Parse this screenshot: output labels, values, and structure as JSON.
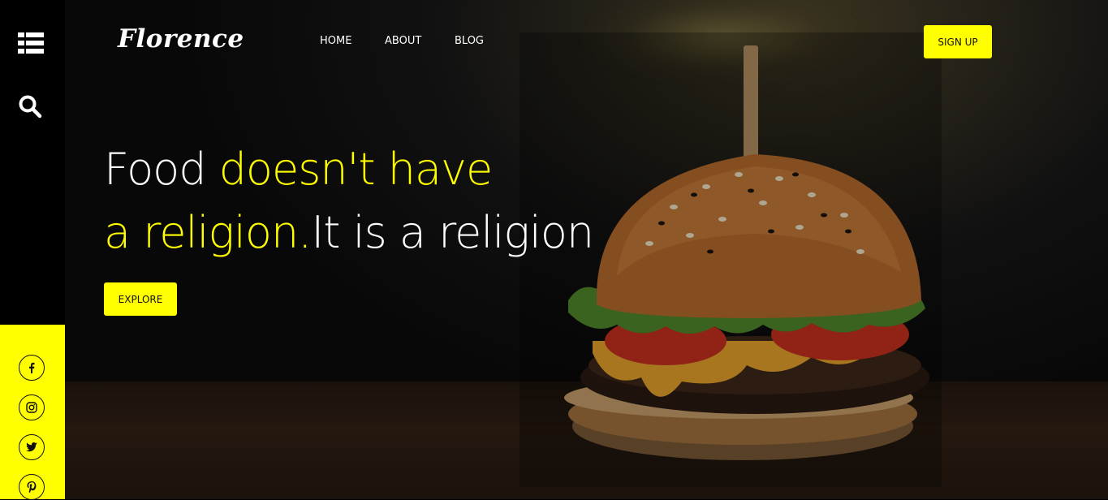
{
  "brand": {
    "logo_text": "Florence"
  },
  "nav": {
    "items": [
      {
        "label": "HOME"
      },
      {
        "label": "ABOUT"
      },
      {
        "label": "BLOG"
      }
    ]
  },
  "header": {
    "signup_label": "SIGN UP"
  },
  "hero": {
    "headline": {
      "line1_white": "Food ",
      "line1_yellow": "doesn't have",
      "line2_yellow": "a religion.",
      "line2_white": "It is a religion"
    },
    "cta_label": "EXPLORE"
  },
  "sidebar": {
    "icons": [
      "list-menu-icon",
      "search-icon"
    ],
    "social": [
      "facebook-icon",
      "instagram-icon",
      "twitter-icon",
      "pinterest-icon"
    ]
  },
  "colors": {
    "accent": "#ffff00",
    "background": "#000000",
    "text": "#ffffff"
  }
}
